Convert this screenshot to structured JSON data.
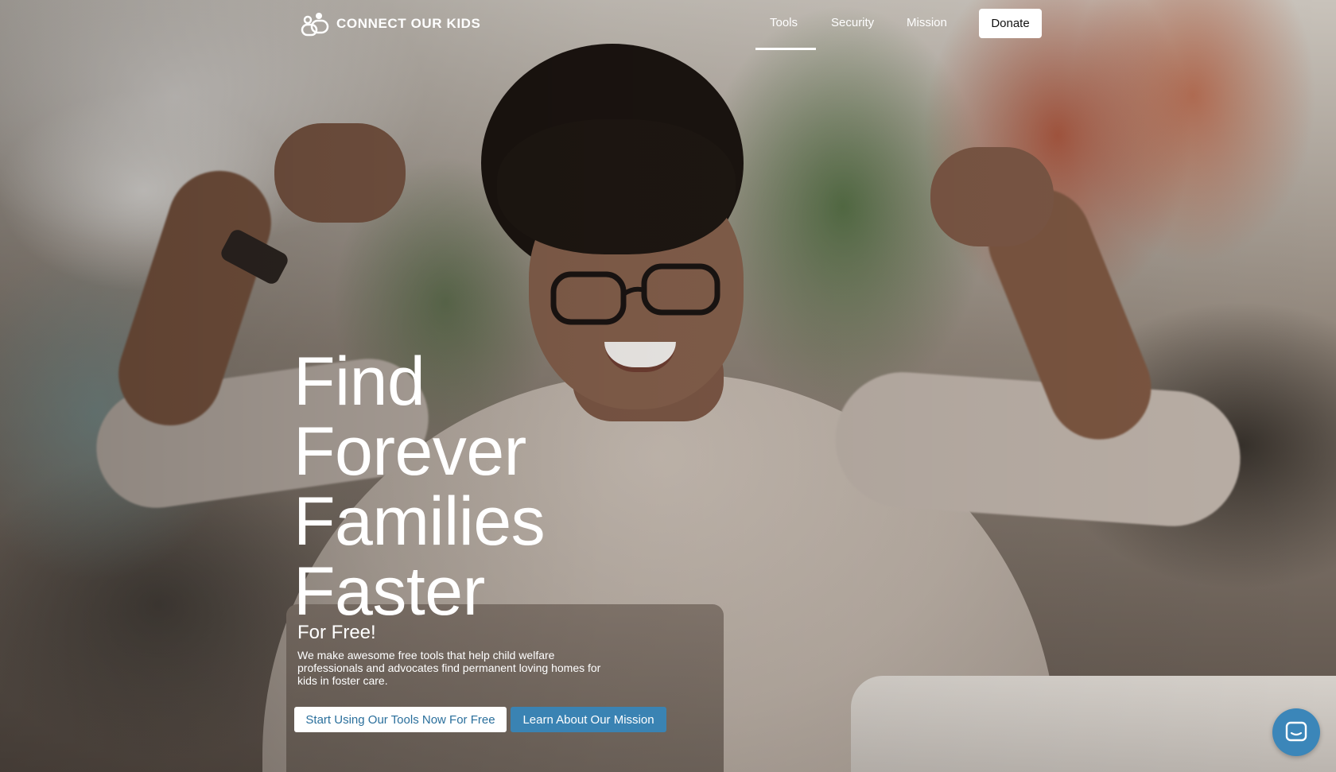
{
  "brand": {
    "name": "CONNECT OUR KIDS",
    "logo_icon": "people-logo-icon"
  },
  "nav": {
    "items": [
      {
        "label": "Tools",
        "active": true
      },
      {
        "label": "Security",
        "active": false
      },
      {
        "label": "Mission",
        "active": false
      }
    ],
    "donate_label": "Donate"
  },
  "hero": {
    "title_lines": [
      "Find",
      "Forever",
      "Families",
      "Faster"
    ],
    "subtitle": "For Free!",
    "description": "We make awesome free tools that help child welfare professionals and advocates find permanent loving homes for kids in foster care.",
    "primary_button": "Start Using Our Tools Now For Free",
    "secondary_button": "Learn About Our Mission"
  },
  "chat": {
    "icon": "chat-icon"
  },
  "colors": {
    "accent": "#3a83b3",
    "primary_button_text": "#2a6f9c",
    "chat_bubble": "#3b86b9",
    "text_on_hero": "#ffffff"
  }
}
